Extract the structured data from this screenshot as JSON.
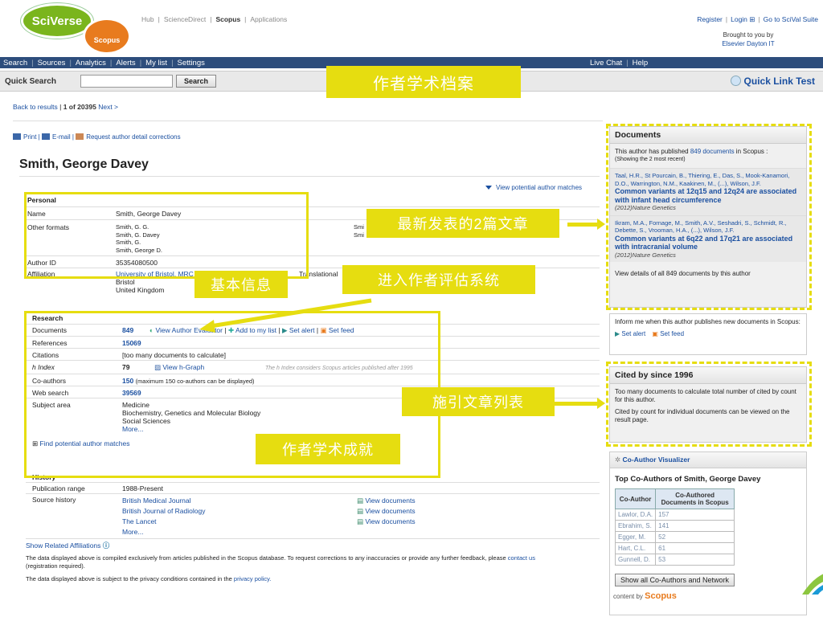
{
  "header": {
    "logo_sciverse": "SciVerse",
    "logo_scopus": "Scopus",
    "topnav": [
      "Hub",
      "ScienceDirect",
      "Scopus",
      "Applications"
    ],
    "toplinks": [
      "Register",
      "Login",
      "Go to SciVal Suite"
    ],
    "brought_by": "Brought to you by",
    "brought_org": "Elsevier Dayton IT"
  },
  "navbar": {
    "items": [
      "Search",
      "Sources",
      "Analytics",
      "Alerts",
      "My list",
      "Settings"
    ],
    "right": [
      "Live Chat",
      "Help"
    ]
  },
  "quicksearch": {
    "label": "Quick Search",
    "button": "Search",
    "quick_link": "Quick Link Test"
  },
  "annotations": {
    "banner": "作者学术档案",
    "basic_info": "基本信息",
    "evaluation": "进入作者评估系统",
    "latest_two": "最新发表的2篇文章",
    "cited_list": "施引文章列表",
    "achievement": "作者学术成就"
  },
  "results": {
    "back": "Back to results",
    "position": "1 of 20395",
    "next": "Next >"
  },
  "actions": {
    "print": "Print",
    "email": "E-mail",
    "request": "Request author detail corrections"
  },
  "author": {
    "name": "Smith, George Davey",
    "view_matches": "View potential author matches",
    "personal_header": "Personal",
    "name_label": "Name",
    "name_value": "Smith, George Davey",
    "other_formats_label": "Other formats",
    "other_formats": [
      "Smith, G. G.",
      "Smith, G. Davey",
      "Smith, G.",
      "Smith, George D."
    ],
    "other_formats_col2": [
      "Smi",
      "Smi"
    ],
    "author_id_label": "Author ID",
    "author_id": "35354080500",
    "affiliation_label": "Affiliation",
    "affiliation": [
      "University of Bristol, MRC",
      "Bristol",
      "United Kingdom"
    ],
    "affiliation_tail": "Translational"
  },
  "research": {
    "header": "Research",
    "documents_label": "Documents",
    "documents": "849",
    "view_author_evaluator": "View Author Evaluator",
    "add_to_list": "Add to my list",
    "set_alert": "Set alert",
    "set_feed": "Set feed",
    "references_label": "References",
    "references": "15069",
    "citations_label": "Citations",
    "citations": "[too many documents to calculate]",
    "hindex_label": "h Index",
    "hindex": "79",
    "view_hgraph": "View h-Graph",
    "hindex_note": "The h Index considers Scopus articles published after 1995",
    "coauthors_label": "Co-authors",
    "coauthors": "150",
    "coauthors_note": "(maximum 150 co-authors can be displayed)",
    "websearch_label": "Web search",
    "websearch": "39569",
    "subject_label": "Subject area",
    "subjects": [
      "Medicine",
      "Biochemistry, Genetics and Molecular Biology",
      "Social Sciences",
      "More..."
    ],
    "find_matches": "Find potential author matches"
  },
  "history": {
    "header": "History",
    "pubrange_label": "Publication range",
    "pubrange": "1988-Present",
    "source_label": "Source history",
    "sources": [
      "British Medical Journal",
      "British Journal of Radiology",
      "The Lancet",
      "More..."
    ],
    "view_documents": "View documents",
    "related": "Show Related Affiliations"
  },
  "footer": {
    "note1": "The data displayed above is compiled exclusively from articles published in the Scopus database. To request corrections to any inaccuracies or provide any further feedback, please",
    "contact": "contact us",
    "note1b": "(registration required).",
    "note2": "The data displayed above is subject to the privacy conditions contained in the",
    "privacy": "privacy policy."
  },
  "sidebar": {
    "documents_title": "Documents",
    "documents_intro_a": "This author has published",
    "documents_count": "849 documents",
    "documents_intro_b": "in Scopus :",
    "documents_showing": "(Showing the 2 most recent)",
    "doc1_authors": "Taal, H.R., St Pourcain, B., Thiering, E., Das, S., Mook-Kanamori, D.O., Warrington, N.M., Kaakinen, M., (...), Wilson, J.F.",
    "doc1_title": "Common variants at 12q15 and 12q24 are associated with infant head circumference",
    "doc1_source": "(2012)Nature Genetics",
    "doc2_authors": "Ikram, M.A., Fornage, M., Smith, A.V., Seshadri, S., Schmidt, R., Debette, S., Vrooman, H.A., (...), Wilson, J.F.",
    "doc2_title": "Common variants at 6q22 and 17q21 are associated with intracranial volume",
    "doc2_source": "(2012)Nature Genetics",
    "view_all": "View details of all 849 documents by this author",
    "inform": "Inform me when this author publishes new documents in Scopus:",
    "set_alert": "Set alert",
    "set_feed": "Set feed",
    "cited_title": "Cited by since 1996",
    "cited_text1": "Too many documents to calculate total number of cited by count for this author.",
    "cited_text2": "Cited by count for individual documents can be viewed on the result page.",
    "coauthor_vis": "Co-Author Visualizer",
    "top_coauthors": "Top Co-Authors of Smith, George Davey",
    "col1": "Co-Author",
    "col2": "Co-Authored Documents in Scopus",
    "coauthors": [
      {
        "name": "Lawlor, D.A.",
        "count": "157"
      },
      {
        "name": "Ebrahim, S.",
        "count": "141"
      },
      {
        "name": "Egger, M.",
        "count": "52"
      },
      {
        "name": "Hart, C.L.",
        "count": "61"
      },
      {
        "name": "Gunnell, D.",
        "count": "53"
      }
    ],
    "show_all": "Show all Co-Authors and Network",
    "content_by": "content by",
    "scopus": "Scopus"
  },
  "colors": {
    "nav": "#2d4d7c",
    "highlight": "#e6dd10",
    "link": "#1a4fa0",
    "sciverse": "#7ab51d",
    "scopus": "#e87b1e"
  }
}
